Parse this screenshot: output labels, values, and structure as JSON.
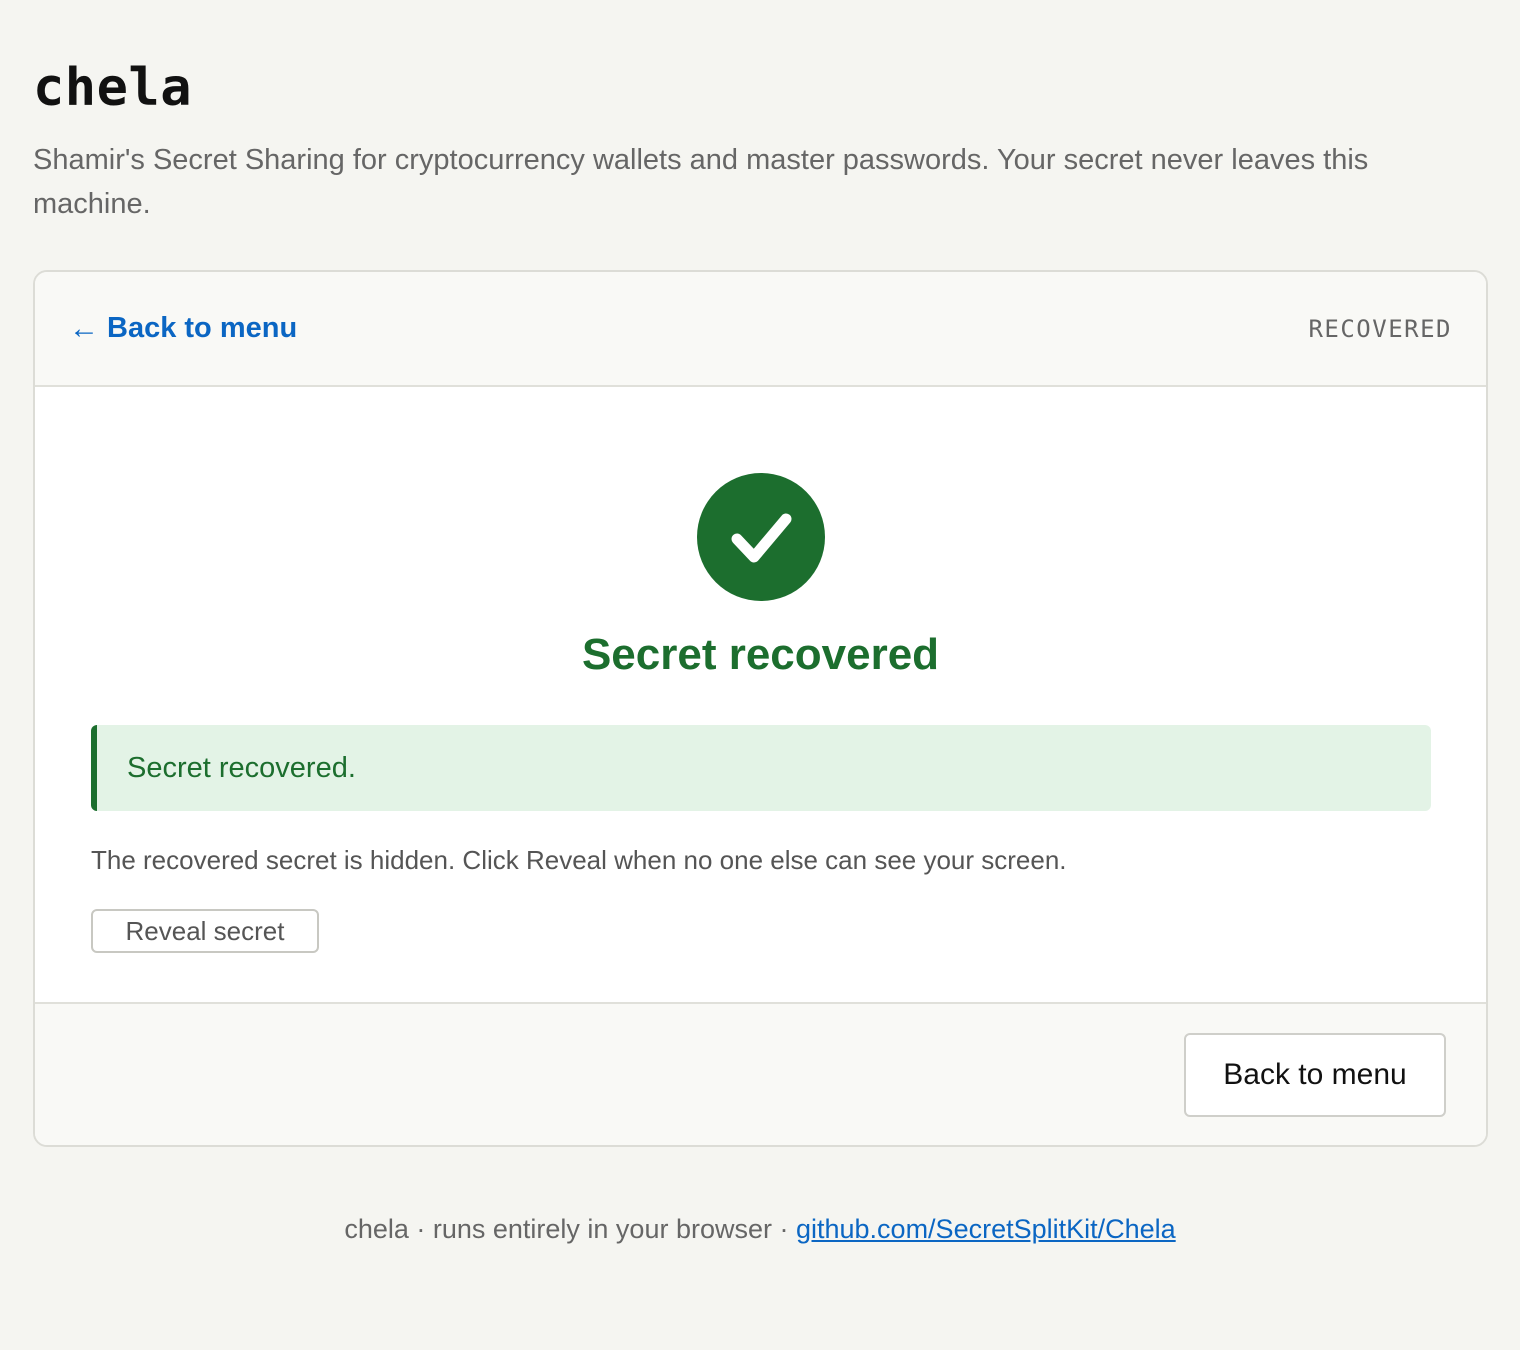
{
  "app": {
    "title": "chela",
    "tagline": "Shamir's Secret Sharing for cryptocurrency wallets and master passwords. Your secret never leaves this machine."
  },
  "card": {
    "header": {
      "back_arrow": "←",
      "back_label": "Back to menu",
      "status": "RECOVERED"
    },
    "success_icon": "check-circle-icon",
    "heading": "Secret recovered",
    "notice": "Secret recovered.",
    "hint": "The recovered secret is hidden. Click Reveal when no one else can see your screen.",
    "reveal_button_label": "Reveal secret",
    "footer_button_label": "Back to menu"
  },
  "footer": {
    "prefix": "chela · runs entirely in your browser · ",
    "link_text": "github.com/SecretSplitKit/Chela"
  },
  "colors": {
    "success_green": "#1c6e2e",
    "notice_bg": "#e3f3e6",
    "link_blue": "#0b66c3",
    "page_bg": "#f5f5f1"
  }
}
